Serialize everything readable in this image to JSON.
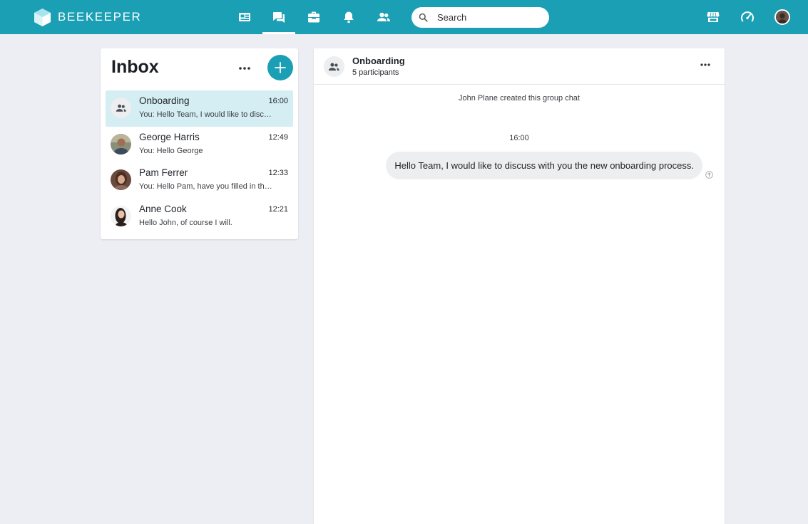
{
  "topbar": {
    "brand_name": "BEEKEEPER",
    "nav": [
      {
        "name": "Streams",
        "icon": "newspaper-icon"
      },
      {
        "name": "Chats",
        "icon": "chat-bubbles-icon",
        "active": true
      },
      {
        "name": "Tools",
        "icon": "toolbox-icon"
      },
      {
        "name": "Notifications",
        "icon": "bell-icon"
      },
      {
        "name": "Colleagues",
        "icon": "people-icon"
      }
    ],
    "search": {
      "placeholder": "Search",
      "value": ""
    },
    "right_icons": [
      "store-icon",
      "speedometer-icon"
    ],
    "accent_color": "#1a9fb4"
  },
  "inbox": {
    "title": "Inbox",
    "chats": [
      {
        "name": "Onboarding",
        "time": "16:00",
        "preview": "You: Hello Team, I would like to discuss with you the new onboarding process.",
        "avatar": "group-icon",
        "selected": true
      },
      {
        "name": "George Harris",
        "time": "12:49",
        "preview": "You: Hello George",
        "avatar": "photo"
      },
      {
        "name": "Pam Ferrer",
        "time": "12:33",
        "preview": "You: Hello Pam, have you filled in the form?",
        "avatar": "photo"
      },
      {
        "name": "Anne Cook",
        "time": "12:21",
        "preview": "Hello John, of course I will.",
        "avatar": "photo"
      }
    ]
  },
  "conversation": {
    "title": "Onboarding",
    "subtitle": "5 participants",
    "system_message": "John Plane created this group chat",
    "timestamp": "16:00",
    "messages": [
      {
        "text": "Hello Team, I would like to discuss with you the new onboarding process.",
        "outgoing": true,
        "status": "sent-icon"
      }
    ]
  }
}
